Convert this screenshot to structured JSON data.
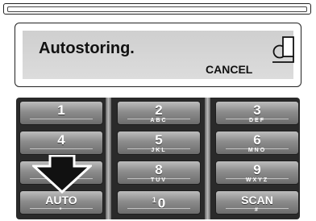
{
  "display": {
    "message": "Autostoring.",
    "cancel_label": "CANCEL"
  },
  "keypad": {
    "keys": [
      {
        "main": "1",
        "sub": ""
      },
      {
        "main": "2",
        "sub": "ABC"
      },
      {
        "main": "3",
        "sub": "DEF"
      },
      {
        "main": "4",
        "sub": ""
      },
      {
        "main": "5",
        "sub": "JKL"
      },
      {
        "main": "6",
        "sub": "MNO"
      },
      {
        "main": "",
        "sub": ""
      },
      {
        "main": "8",
        "sub": "TUV"
      },
      {
        "main": "9",
        "sub": "WXYZ"
      },
      {
        "main": "AUTO",
        "sub": "*"
      },
      {
        "main": "0",
        "sup": "1",
        "sub": ""
      },
      {
        "main": "SCAN",
        "sub": "#"
      }
    ]
  },
  "overlay": {
    "arrow_icon": "down-arrow-icon",
    "cancel_icon": "cancel-key-icon"
  }
}
